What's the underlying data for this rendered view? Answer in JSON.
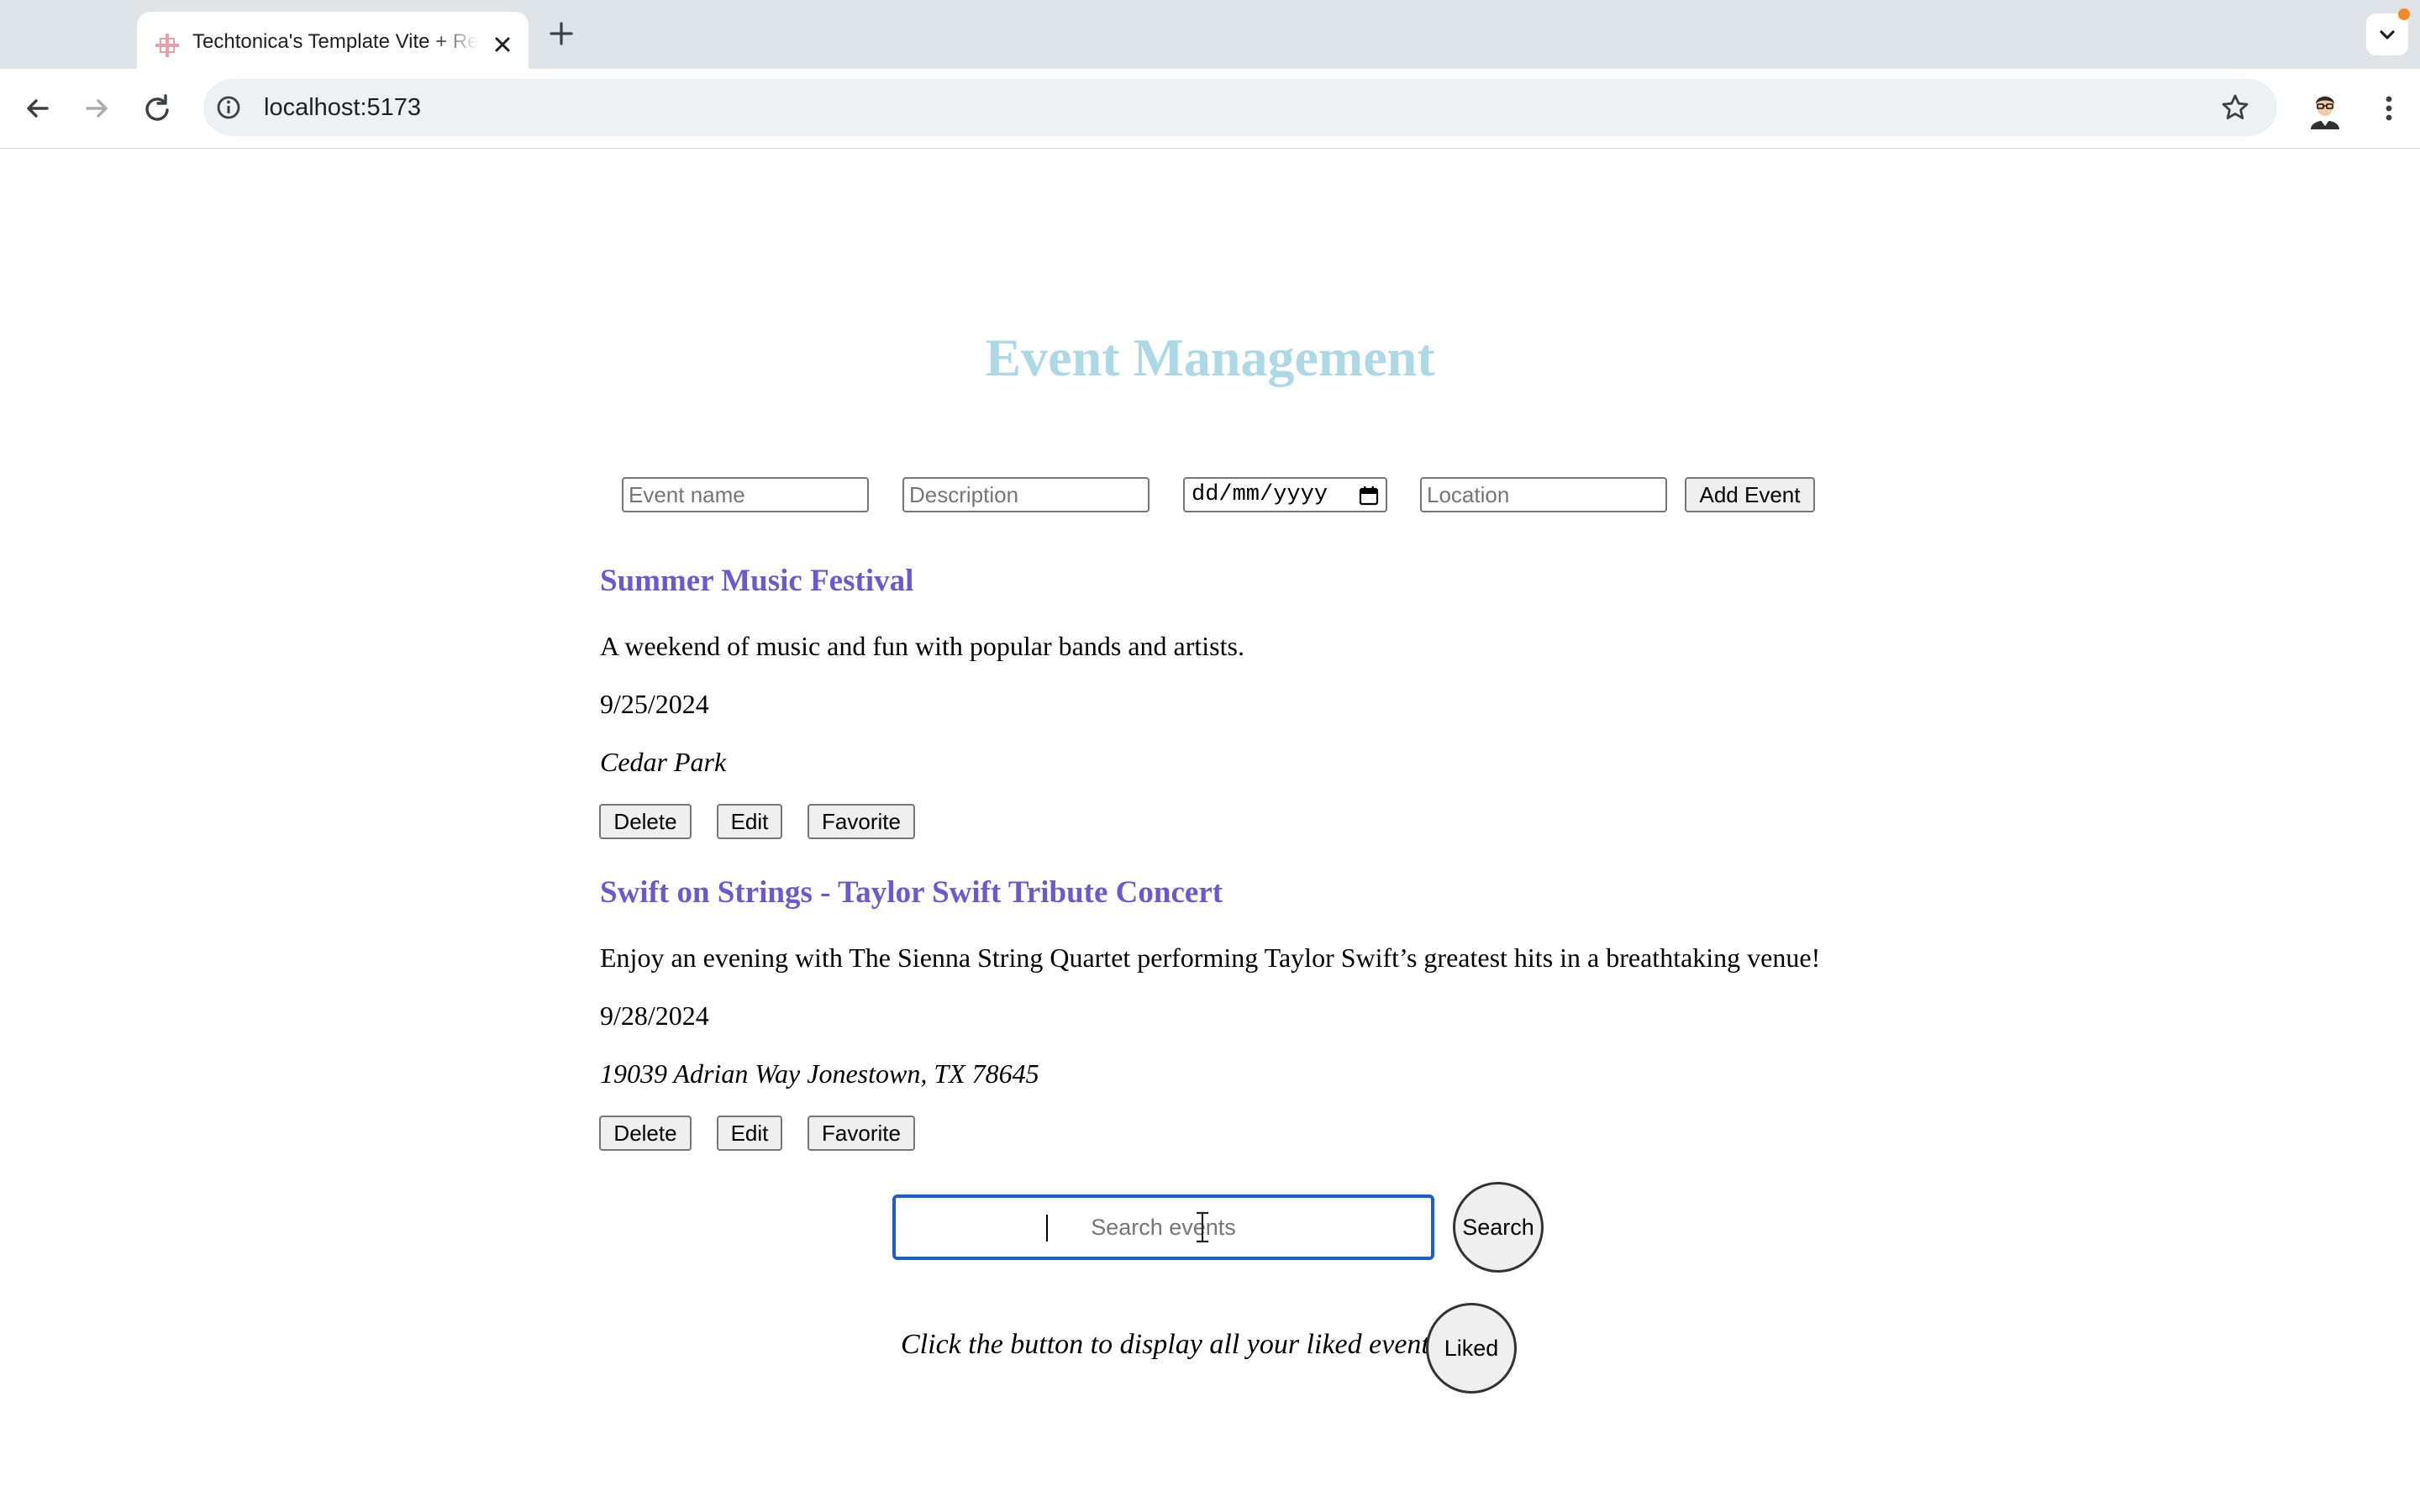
{
  "browser": {
    "tab": {
      "title": "Techtonica's Template Vite + React",
      "favicon": "react-favicon-icon"
    },
    "new_tab_label": "+",
    "url": "localhost:5173",
    "icons": {
      "back": "back-arrow-icon",
      "forward": "forward-arrow-icon",
      "reload": "reload-icon",
      "site_info": "info-icon",
      "bookmark": "star-icon",
      "profile": "avatar-icon",
      "menu": "kebab-menu-icon",
      "tab_search": "chevron-down-icon"
    },
    "colors": {
      "tabstrip": "#dfe4e8",
      "omnibox": "#eef1f4",
      "notification_dot": "#f28b24"
    }
  },
  "page": {
    "title": "Event Management",
    "colors": {
      "title": "#add8e6",
      "event_title": "#6a5acd",
      "search_focus": "#1a5fc8"
    },
    "form": {
      "name_placeholder": "Event name",
      "description_placeholder": "Description",
      "date_placeholder": "dd/mm/yyyy",
      "location_placeholder": "Location",
      "submit_label": "Add Event"
    },
    "events": [
      {
        "title": "Summer Music Festival",
        "description": "A weekend of music and fun with popular bands and artists.",
        "date": "9/25/2024",
        "location": "Cedar Park",
        "actions": {
          "delete": "Delete",
          "edit": "Edit",
          "favorite": "Favorite"
        }
      },
      {
        "title": "Swift on Strings - Taylor Swift Tribute Concert",
        "description": "Enjoy an evening with The Sienna String Quartet performing Taylor Swift’s greatest hits in a breathtaking venue!",
        "date": "9/28/2024",
        "location": "19039 Adrian Way Jonestown, TX 78645",
        "actions": {
          "delete": "Delete",
          "edit": "Edit",
          "favorite": "Favorite"
        }
      }
    ],
    "search": {
      "placeholder": "Search events",
      "value": "",
      "button_label": "Search"
    },
    "liked": {
      "message": "Click the button to display all your liked events!",
      "button_label": "Liked"
    }
  }
}
